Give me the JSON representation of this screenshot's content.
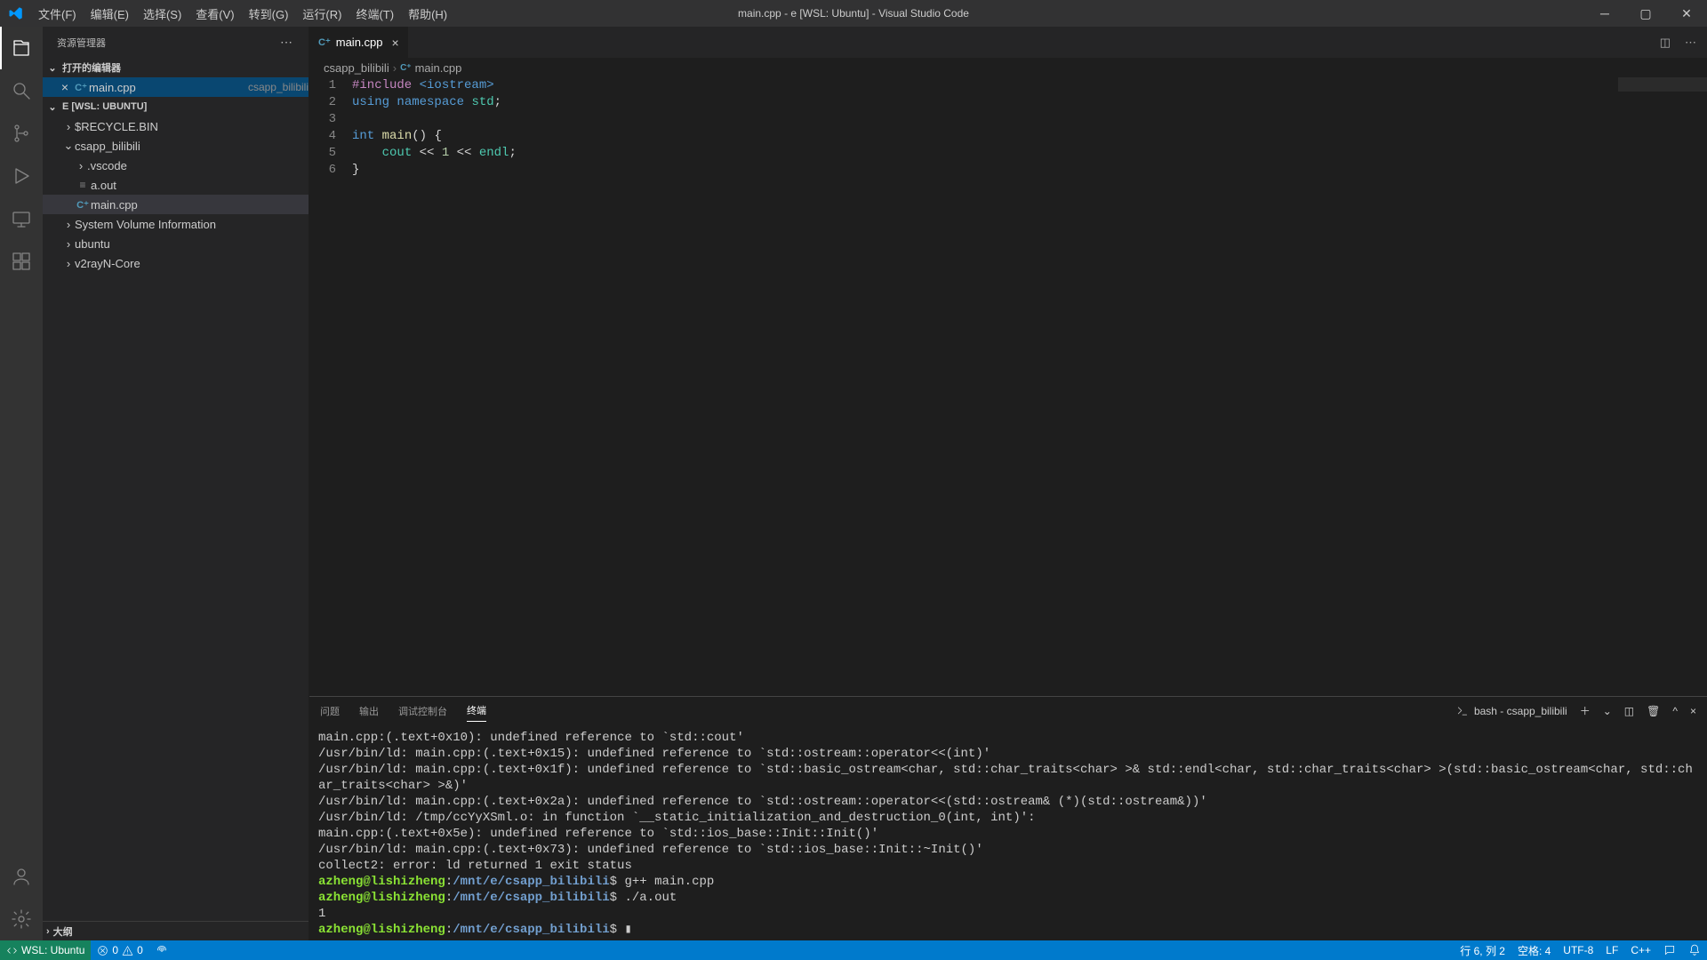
{
  "title": "main.cpp - e [WSL: Ubuntu] - Visual Studio Code",
  "menu": [
    "文件(F)",
    "编辑(E)",
    "选择(S)",
    "查看(V)",
    "转到(G)",
    "运行(R)",
    "终端(T)",
    "帮助(H)"
  ],
  "explorer": {
    "title": "资源管理器",
    "openEditors": "打开的编辑器",
    "workspace": "E [WSL: UBUNTU]",
    "outline": "大纲",
    "openItem": {
      "name": "main.cpp",
      "desc": "csapp_bilibili"
    },
    "tree": [
      {
        "indent": 1,
        "chev": "›",
        "name": "$RECYCLE.BIN"
      },
      {
        "indent": 1,
        "chev": "⌄",
        "name": "csapp_bilibili"
      },
      {
        "indent": 2,
        "chev": "›",
        "name": ".vscode"
      },
      {
        "indent": 2,
        "icon": "file",
        "name": "a.out"
      },
      {
        "indent": 2,
        "icon": "cpp",
        "name": "main.cpp",
        "active": true
      },
      {
        "indent": 1,
        "chev": "›",
        "name": "System Volume Information"
      },
      {
        "indent": 1,
        "chev": "›",
        "name": "ubuntu"
      },
      {
        "indent": 1,
        "chev": "›",
        "name": "v2rayN-Core"
      }
    ]
  },
  "tab": {
    "name": "main.cpp"
  },
  "breadcrumb": {
    "folder": "csapp_bilibili",
    "file": "main.cpp"
  },
  "code": [
    {
      "n": 1,
      "html": "<span class='dir'>#include</span> <span class='inc'>&lt;iostream&gt;</span>"
    },
    {
      "n": 2,
      "html": "<span class='kw'>using</span> <span class='kw'>namespace</span> <span class='str'>std</span>;"
    },
    {
      "n": 3,
      "html": ""
    },
    {
      "n": 4,
      "html": "<span class='kw'>int</span> <span class='fn'>main</span>() {"
    },
    {
      "n": 5,
      "html": "    <span class='str'>cout</span> &lt;&lt; <span class='num'>1</span> &lt;&lt; <span class='str'>endl</span>;"
    },
    {
      "n": 6,
      "html": "}"
    }
  ],
  "panel": {
    "tabs": [
      "问题",
      "输出",
      "调试控制台",
      "终端"
    ],
    "active": 3,
    "termLabel": "bash - csapp_bilibili",
    "lines": [
      {
        "t": "main.cpp:(.text+0x10): undefined reference to `std::cout'"
      },
      {
        "t": "/usr/bin/ld: main.cpp:(.text+0x15): undefined reference to `std::ostream::operator<<(int)'"
      },
      {
        "t": "/usr/bin/ld: main.cpp:(.text+0x1f): undefined reference to `std::basic_ostream<char, std::char_traits<char> >& std::endl<char, std::char_traits<char> >(std::basic_ostream<char, std::char_traits<char> >&)'"
      },
      {
        "t": "/usr/bin/ld: main.cpp:(.text+0x2a): undefined reference to `std::ostream::operator<<(std::ostream& (*)(std::ostream&))'"
      },
      {
        "t": "/usr/bin/ld: /tmp/ccYyXSml.o: in function `__static_initialization_and_destruction_0(int, int)':"
      },
      {
        "t": "main.cpp:(.text+0x5e): undefined reference to `std::ios_base::Init::Init()'"
      },
      {
        "t": "/usr/bin/ld: main.cpp:(.text+0x73): undefined reference to `std::ios_base::Init::~Init()'"
      },
      {
        "t": "collect2: error: ld returned 1 exit status"
      },
      {
        "p": true,
        "cmd": "g++ main.cpp"
      },
      {
        "p": true,
        "cmd": "./a.out"
      },
      {
        "t": "1"
      },
      {
        "p": true,
        "cmd": "▮"
      }
    ],
    "promptUser": "azheng@lishizheng",
    "promptPath": "/mnt/e/csapp_bilibili"
  },
  "status": {
    "remote": "WSL: Ubuntu",
    "errors": "0",
    "warnings": "0",
    "ln": "行 6, 列 2",
    "spaces": "空格: 4",
    "enc": "UTF-8",
    "eol": "LF",
    "lang": "C++"
  }
}
